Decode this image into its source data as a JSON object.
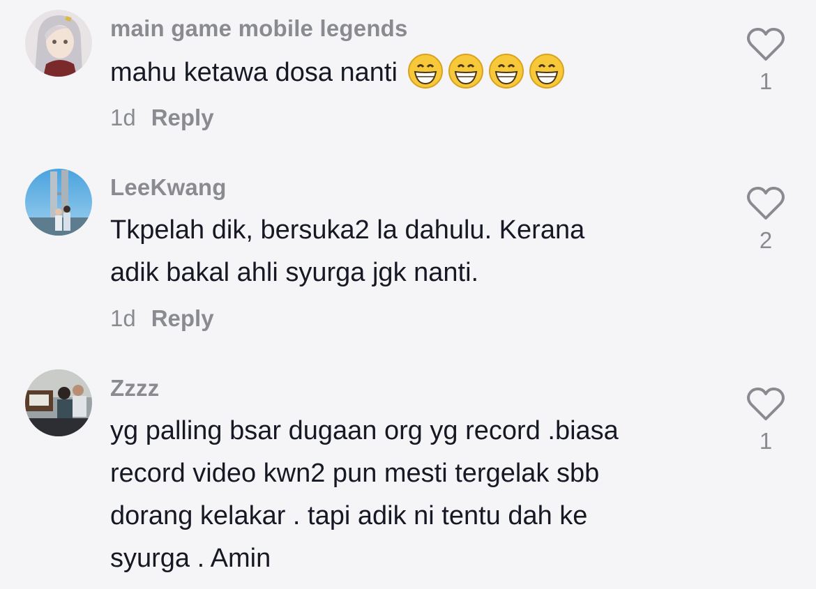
{
  "comments": [
    {
      "username": "main game mobile legends",
      "text_lines": [
        "mahu ketawa dosa nanti"
      ],
      "emojis": [
        "grinning-face",
        "grinning-face",
        "grinning-face",
        "grinning-face"
      ],
      "time": "1d",
      "reply_label": "Reply",
      "likes": "1"
    },
    {
      "username": "LeeKwang",
      "text_lines": [
        "Tkpelah dik, bersuka2 la dahulu. Kerana",
        "adik bakal ahli syurga jgk nanti."
      ],
      "time": "1d",
      "reply_label": "Reply",
      "likes": "2"
    },
    {
      "username": "Zzzz",
      "text_lines": [
        "yg palling bsar dugaan org yg record .biasa",
        "record video kwn2 pun mesti tergelak sbb",
        "dorang kelakar . tapi adik ni tentu dah ke",
        "syurga . Amin"
      ],
      "likes": "1"
    }
  ],
  "colors": {
    "background": "#f5f5f7",
    "text": "#161823",
    "secondary": "#8a8b91"
  }
}
